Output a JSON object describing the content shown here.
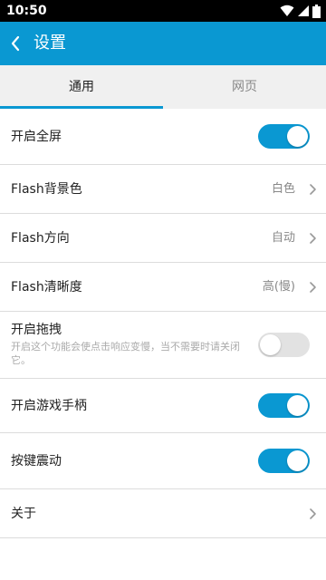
{
  "status_bar": {
    "time": "10:50",
    "icons": [
      "wifi-icon",
      "signal-icon",
      "battery-icon"
    ]
  },
  "app_bar": {
    "back_icon": "chevron-left-icon",
    "title": "设置"
  },
  "tabs": [
    {
      "label": "通用",
      "selected": true
    },
    {
      "label": "网页",
      "selected": false
    }
  ],
  "settings": {
    "fullscreen": {
      "label": "开启全屏",
      "enabled": true
    },
    "flash_bg_color": {
      "label": "Flash背景色",
      "value": "白色"
    },
    "flash_orientation": {
      "label": "Flash方向",
      "value": "自动"
    },
    "flash_quality": {
      "label": "Flash清晰度",
      "value": "高(慢)"
    },
    "drag": {
      "label": "开启拖拽",
      "description": "开启这个功能会使点击响应变慢，当不需要时请关闭它。",
      "enabled": false
    },
    "gamepad": {
      "label": "开启游戏手柄",
      "enabled": true
    },
    "key_vibration": {
      "label": "按键震动",
      "enabled": true
    },
    "about": {
      "label": "关于"
    }
  },
  "colors": {
    "accent": "#0a98d2",
    "toggle_off": "#e2e2e2",
    "tab_bar": "#f0f0f0",
    "divider": "#dcdcdc"
  }
}
